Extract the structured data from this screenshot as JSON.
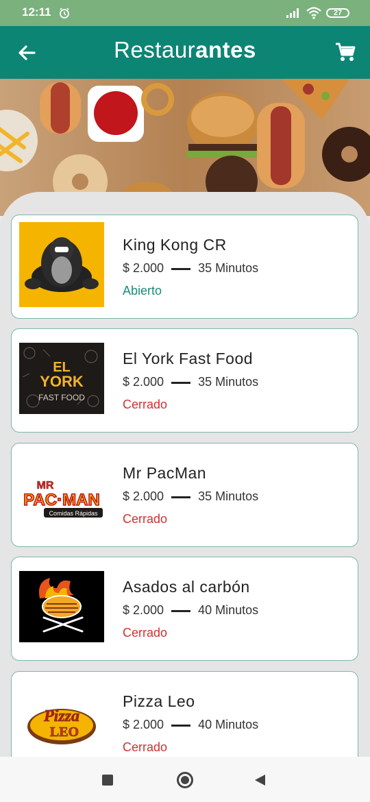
{
  "status_bar": {
    "time": "12:11",
    "battery": "27"
  },
  "app_bar": {
    "title_light": "Restaur",
    "title_bold": "antes"
  },
  "restaurants": [
    {
      "name": "King Kong CR",
      "price": "$ 2.000",
      "time": "35 Minutos",
      "status": "Abierto",
      "status_kind": "open"
    },
    {
      "name": "El York Fast Food",
      "price": "$ 2.000",
      "time": "35 Minutos",
      "status": "Cerrado",
      "status_kind": "closed",
      "logo_text": "EL YORK FAST FOOD"
    },
    {
      "name": "Mr PacMan",
      "price": "$ 2.000",
      "time": "35 Minutos",
      "status": "Cerrado",
      "status_kind": "closed",
      "logo_text": "MR PAC-MAN Comidas Rápidas"
    },
    {
      "name": "Asados al carbón",
      "price": "$ 2.000",
      "time": "40 Minutos",
      "status": "Cerrado",
      "status_kind": "closed"
    },
    {
      "name": "Pizza Leo",
      "price": "$ 2.000",
      "time": "40 Minutos",
      "status": "Cerrado",
      "status_kind": "closed",
      "logo_text": "Pizza LEO"
    }
  ],
  "icons": {
    "back": "arrow-left-icon",
    "cart": "shopping-cart-icon",
    "alarm": "alarm-clock-icon",
    "signal": "signal-icon",
    "wifi": "wifi-icon",
    "battery": "battery-icon"
  },
  "colors": {
    "primary": "#0d8574",
    "status_bar": "#7ab17d",
    "open": "#1a8b79",
    "closed": "#d32f2f"
  }
}
